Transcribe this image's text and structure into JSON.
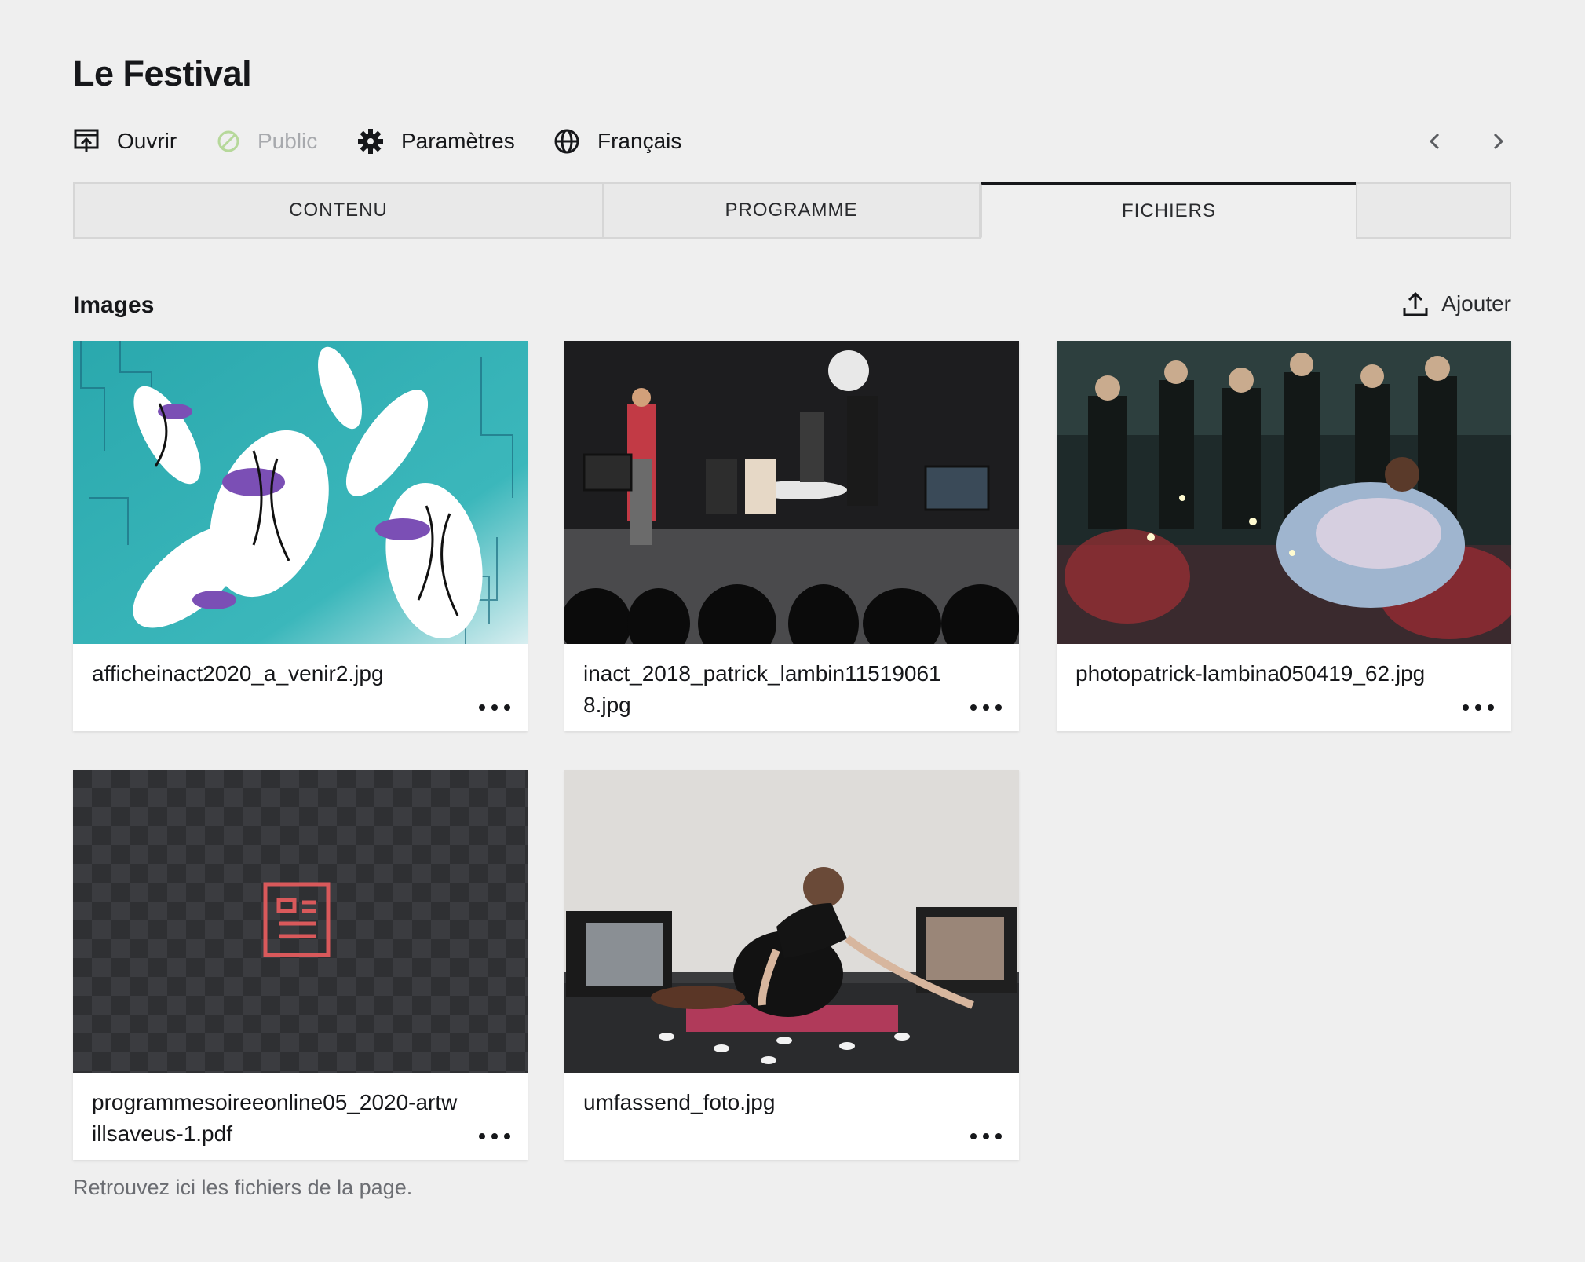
{
  "page": {
    "title": "Le Festival"
  },
  "toolbar": {
    "open_label": "Ouvrir",
    "status_label": "Public",
    "settings_label": "Paramètres",
    "language_label": "Français"
  },
  "tabs": [
    {
      "label": "CONTENU"
    },
    {
      "label": "PROGRAMME"
    },
    {
      "label": "FICHIERS",
      "active": true
    },
    {
      "label": ""
    }
  ],
  "section": {
    "title": "Images",
    "add_label": "Ajouter"
  },
  "files": [
    {
      "name": "afficheinact2020_a_venir2.jpg",
      "type": "image"
    },
    {
      "name": "inact_2018_patrick_lambin115190618.jpg",
      "type": "image"
    },
    {
      "name": "photopatrick-lambina050419_62.jpg",
      "type": "image"
    },
    {
      "name": "programmesoireeonline05_2020-artwillsaveus-1.pdf",
      "type": "document"
    },
    {
      "name": "umfassend_foto.jpg",
      "type": "image"
    }
  ],
  "help_text": "Retrouvez ici les fichiers de la page.",
  "colors": {
    "accent_doc": "#d9595b",
    "active_tab_border": "#16171a",
    "status_muted": "#a7a9ad"
  }
}
